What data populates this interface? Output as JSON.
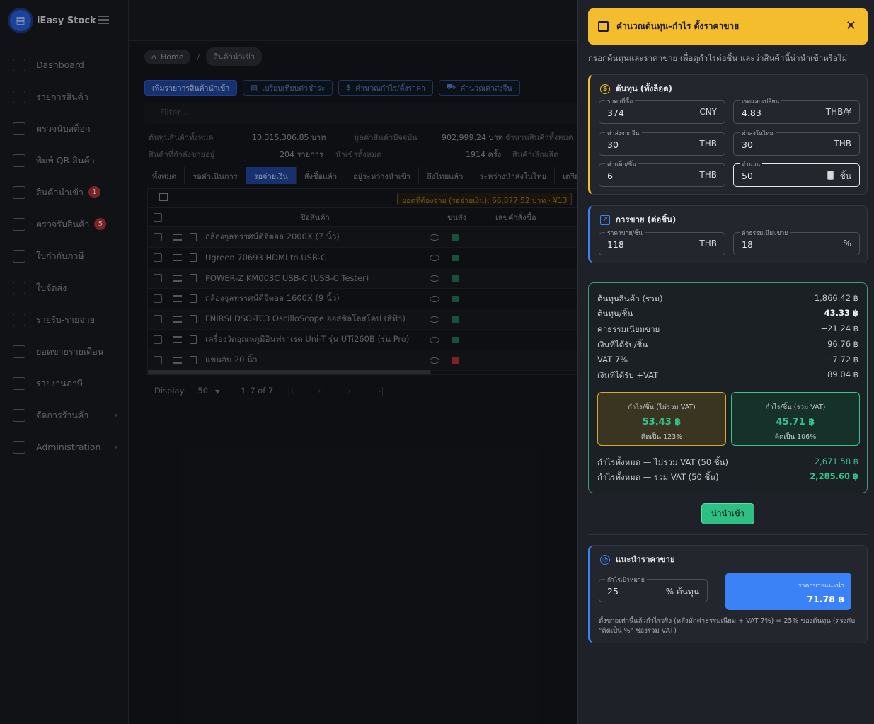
{
  "sidebar": {
    "brand": "iEasy Stock",
    "items": [
      {
        "label": "Dashboard",
        "icon": "home-icon",
        "badge": ""
      },
      {
        "label": "รายการสินค้า",
        "icon": "products-icon",
        "badge": ""
      },
      {
        "label": "ตรวจนับสต็อก",
        "icon": "scan-icon",
        "badge": ""
      },
      {
        "label": "พิมพ์ QR สินค้า",
        "icon": "qr-icon",
        "badge": ""
      },
      {
        "label": "สินค้านำเข้า",
        "icon": "import-icon",
        "badge": "1"
      },
      {
        "label": "ตรวจรับสินค้า",
        "icon": "receive-icon",
        "badge": "5"
      },
      {
        "label": "ใบกำกับภาษี",
        "icon": "invoice-icon",
        "badge": ""
      },
      {
        "label": "ใบจัดส่ง",
        "icon": "truck-icon",
        "badge": ""
      },
      {
        "label": "รายรับ-รายจ่าย",
        "icon": "transfer-icon",
        "badge": ""
      },
      {
        "label": "ยอดขายรายเดือน",
        "icon": "trend-icon",
        "badge": ""
      },
      {
        "label": "รายงานภาษี",
        "icon": "report-icon",
        "badge": ""
      },
      {
        "label": "จัดการร้านค้า",
        "icon": "store-icon",
        "badge": "",
        "chevron": "›"
      },
      {
        "label": "Administration",
        "icon": "admin-icon",
        "badge": "",
        "chevron": "›"
      }
    ]
  },
  "breadcrumb": {
    "home": "Home",
    "sep": "/",
    "current": "สินค้านำเข้า"
  },
  "toolbar": {
    "add": "เพิ่มรายการสินค้านำเข้า",
    "compare": "เปรียบเทียบค่าชำระ",
    "profit": "คำนวณกำไร/ตั้งราคา",
    "shipping": "คำนวณค่าส่งจีน"
  },
  "filter": {
    "placeholder": "Filter..."
  },
  "stats": {
    "row1": [
      {
        "label": "ต้นทุนสินค้าทั้งหมด"
      },
      {
        "value": "10,315,306.85 บาท"
      },
      {
        "label": "มูลค่าสินค้าปัจจุบัน"
      },
      {
        "value": "902,999.24 บาท"
      },
      {
        "label": "จำนวนสินค้าทั้งหมด"
      }
    ],
    "row2": [
      {
        "label": "สินค้าที่กำลังขายอยู่"
      },
      {
        "value": "204 รายการ"
      },
      {
        "label": "นำเข้าทั้งหมด"
      },
      {
        "value": "1914 ครั้ง"
      },
      {
        "label": "สินค้าเลิกผลิต"
      }
    ]
  },
  "tabs": [
    "ทั้งหมด",
    "รอดำเนินการ",
    "รอจ่ายเงิน",
    "สั่งซื้อแล้ว",
    "อยู่ระหว่างนำเข้า",
    "ถึงไทยแล้ว",
    "ระหว่างนำส่งในไทย",
    "เตรียมว"
  ],
  "grid": {
    "due": "ยอดที่ต้องจ่าย (รอจ่ายเงิน): 66,877.52 บาท · ¥13",
    "headers": {
      "name": "ชื่อสินค้า",
      "ship": "ขนส่ง",
      "order": "เลขคำสั่งซื้อ"
    },
    "rows": [
      {
        "name": "กล้องจุลทรรศน์ดิจิตอล 2000X (7 นิ้ว)",
        "ship": "green"
      },
      {
        "name": "Ugreen 70693 HDMI to USB-C",
        "ship": "green"
      },
      {
        "name": "POWER-Z KM003C USB-C (USB-C Tester)",
        "ship": "green"
      },
      {
        "name": "กล้องจุลทรรศน์ดิจิตอล 1600X (9 นิ้ว)",
        "ship": "green"
      },
      {
        "name": "FNIRSI DSO-TC3 OscilloScope ออสซิลโลสโคป (สีฟ้า)",
        "ship": "green"
      },
      {
        "name": "เครื่องวัดอุณหภูมิอินฟราเรด Uni-T รุ่น UTi260B (รุ่น Pro)",
        "ship": "green"
      },
      {
        "name": "แขนจับ 20 นิ้ว",
        "ship": "red"
      }
    ]
  },
  "pager": {
    "label": "Display:",
    "size": "50",
    "range": "1–7 of 7"
  },
  "panel": {
    "title": "คำนวณต้นทุน–กำไร ตั้งราคาขาย",
    "desc": "กรอกต้นทุนและราคาขาย เพื่อดูกำไรต่อชิ้น และว่าสินค้านี้น่านำเข้าหรือไม่",
    "cost": {
      "title": "ต้นทุน (ทั้งล็อต)",
      "buy_price": {
        "label": "ราคาที่ซื้อ",
        "value": "374",
        "unit": "CNY"
      },
      "rate": {
        "label": "เรตแลกเปลี่ยน",
        "value": "4.83",
        "unit": "THB/¥"
      },
      "ship_cn": {
        "label": "ค่าส่งจากจีน",
        "value": "30",
        "unit": "THB"
      },
      "ship_th": {
        "label": "ค่าส่งในไทย",
        "value": "30",
        "unit": "THB"
      },
      "pack": {
        "label": "ค่าแพ็ก/ชิ้น",
        "value": "6",
        "unit": "THB"
      },
      "qty": {
        "label": "จำนวน",
        "value": "50",
        "unit": "ชิ้น"
      }
    },
    "sale": {
      "title": "การขาย (ต่อชิ้น)",
      "price": {
        "label": "ราคาขาย/ชิ้น",
        "value": "118",
        "unit": "THB"
      },
      "fee": {
        "label": "ค่าธรรมเนียมขาย",
        "value": "18",
        "unit": "%"
      }
    },
    "result": {
      "lines": [
        {
          "label": "ต้นทุนสินค้า (รวม)",
          "value": "1,866.42 ฿"
        },
        {
          "label": "ต้นทุน/ชิ้น",
          "value": "43.33 ฿"
        },
        {
          "label": "ค่าธรรมเนียมขาย",
          "value": "−21.24 ฿"
        },
        {
          "label": "เงินที่ได้รับ/ชิ้น",
          "value": "96.76 ฿"
        },
        {
          "label": "VAT 7%",
          "value": "−7.72 ฿"
        },
        {
          "label": "เงินที่ได้รับ +VAT",
          "value": "89.04 ฿"
        }
      ],
      "box1": {
        "title": "กำไร/ชิ้น (ไม่รวม VAT)",
        "value": "53.43 ฿",
        "pct": "คิดเป็น 123%"
      },
      "box2": {
        "title": "กำไร/ชิ้น (รวม VAT)",
        "value": "45.71 ฿",
        "pct": "คิดเป็น 106%"
      },
      "total1": {
        "label": "กำไรทั้งหมด — ไม่รวม VAT (50 ชิ้น)",
        "value": "2,671.58 ฿"
      },
      "total2": {
        "label": "กำไรทั้งหมด — รวม VAT (50 ชิ้น)",
        "value": "2,285.60 ฿"
      }
    },
    "import_button": "น่านำเข้า",
    "suggest": {
      "title": "แนะนำราคาขาย",
      "target": {
        "label": "กำไรเป้าหมาย",
        "value": "25",
        "unit": "% ต้นทุน"
      },
      "rec_label": "ราคาขายแนะนำ",
      "rec_value": "71.78 ฿",
      "note": "ตั้งขายเท่านี้แล้วกำไรจริง (หลังหักค่าธรรมเนียม + VAT 7%) = 25% ของต้นทุน (ตรงกับ \"คิดเป็น %\" ช่องรวม VAT)"
    }
  }
}
